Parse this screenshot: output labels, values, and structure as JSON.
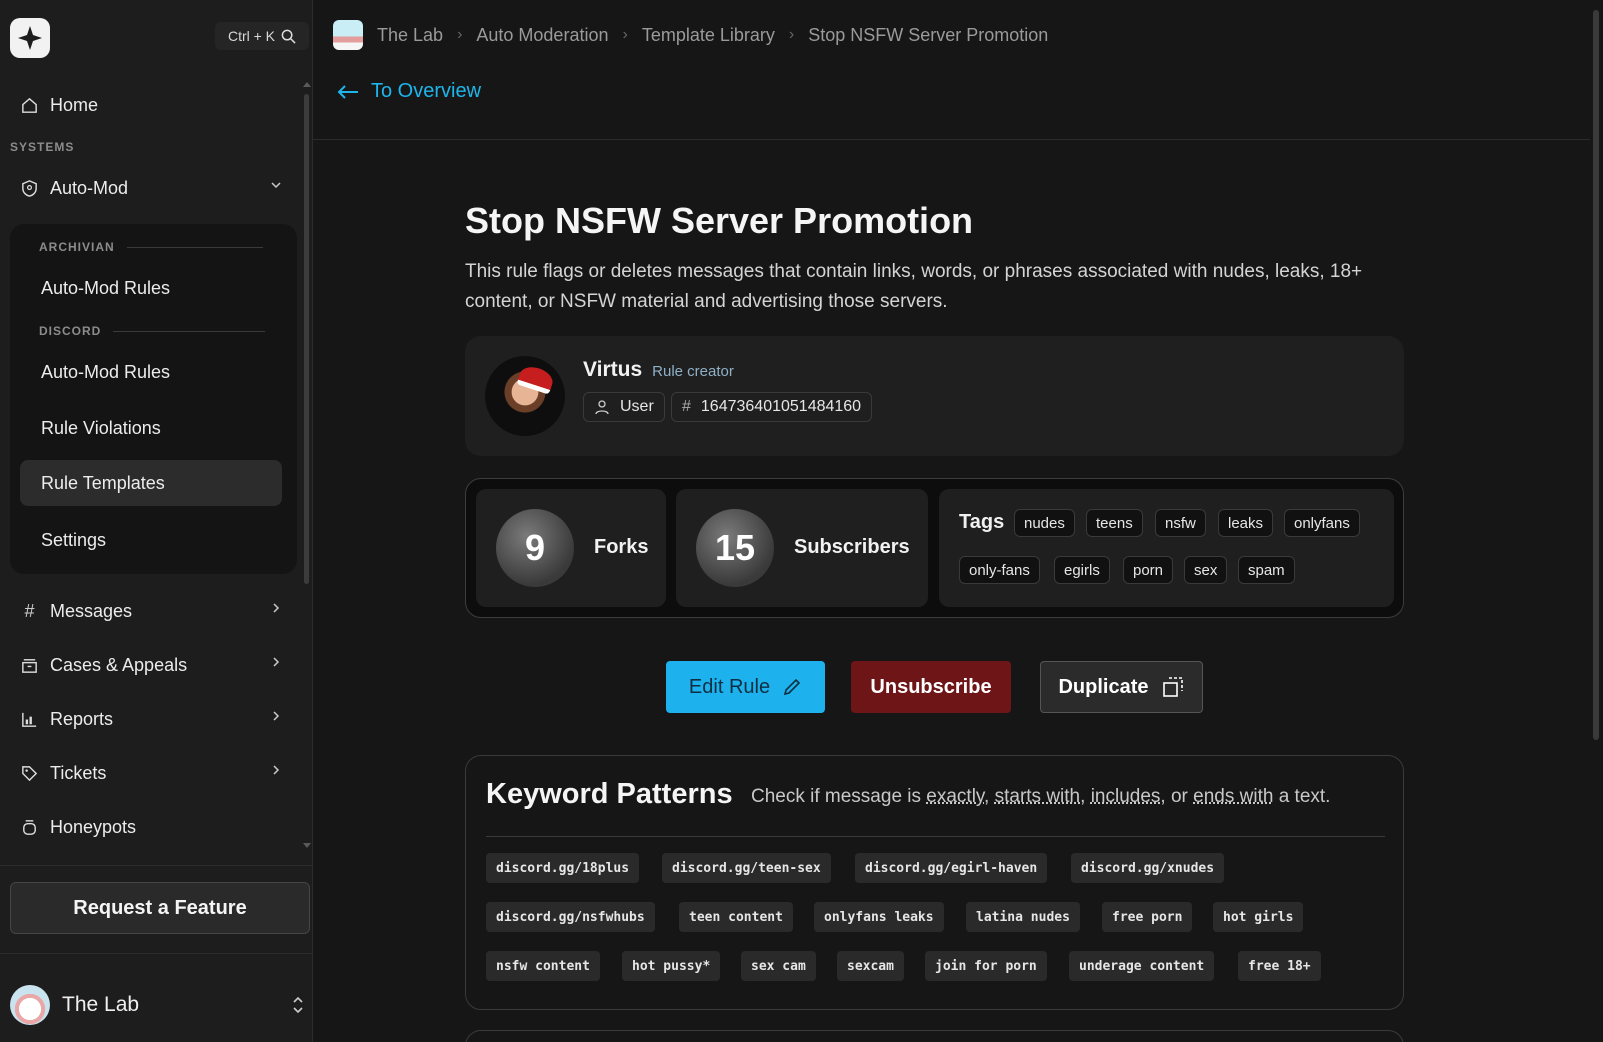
{
  "search": {
    "shortcut": "Ctrl + K"
  },
  "sidebar": {
    "home": "Home",
    "systems_label": "SYSTEMS",
    "automod": "Auto-Mod",
    "archivian_label": "ARCHIVIAN",
    "archivian_rules": "Auto-Mod Rules",
    "discord_label": "DISCORD",
    "discord_rules": "Auto-Mod Rules",
    "rule_violations": "Rule Violations",
    "rule_templates": "Rule Templates",
    "settings": "Settings",
    "messages": "Messages",
    "cases": "Cases & Appeals",
    "reports": "Reports",
    "tickets": "Tickets",
    "honeypots": "Honeypots",
    "request_feature": "Request a Feature",
    "workspace": "The Lab"
  },
  "breadcrumbs": [
    "The Lab",
    "Auto Moderation",
    "Template Library",
    "Stop NSFW Server Promotion"
  ],
  "back_link": "To Overview",
  "rule": {
    "title": "Stop NSFW Server Promotion",
    "description": "This rule flags or deletes messages that contain links, words, or phrases associated with nudes, leaks, 18+ content, or NSFW material and advertising those servers."
  },
  "creator": {
    "name": "Virtus",
    "role": "Rule creator",
    "type": "User",
    "id": "164736401051484160"
  },
  "stats": {
    "forks": "9",
    "forks_label": "Forks",
    "subscribers": "15",
    "subscribers_label": "Subscribers",
    "tags_label": "Tags",
    "tags": [
      "nudes",
      "teens",
      "nsfw",
      "leaks",
      "onlyfans",
      "only-fans",
      "egirls",
      "porn",
      "sex",
      "spam"
    ]
  },
  "actions": {
    "edit": "Edit Rule",
    "unsubscribe": "Unsubscribe",
    "duplicate": "Duplicate"
  },
  "keywords": {
    "title": "Keyword Patterns",
    "sub_prefix": "Check if message is ",
    "sub_exactly": "exactly",
    "sub_starts": "starts with",
    "sub_includes": "includes",
    "sub_or": ", or ",
    "sub_ends": "ends with",
    "sub_suffix": " a text.",
    "items": [
      "discord.gg/18plus",
      "discord.gg/teen-sex",
      "discord.gg/egirl-haven",
      "discord.gg/xnudes",
      "discord.gg/nsfwhubs",
      "teen content",
      "onlyfans leaks",
      "latina nudes",
      "free porn",
      "hot girls",
      "nsfw content",
      "hot pussy*",
      "sex cam",
      "sexcam",
      "join for porn",
      "underage content",
      "free 18+"
    ]
  },
  "colors": {
    "accent": "#1db2ee",
    "danger": "#6e1518",
    "background": "#161616"
  }
}
